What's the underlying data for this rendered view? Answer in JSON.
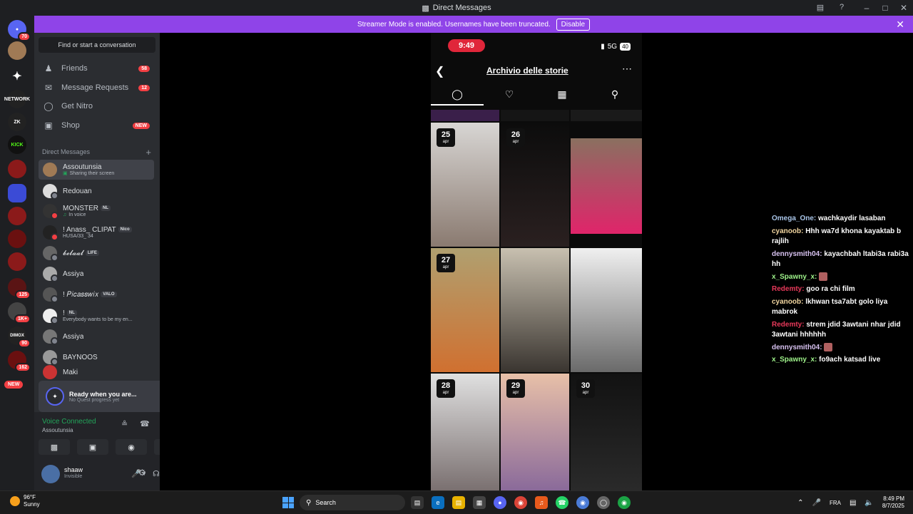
{
  "window": {
    "title": "Direct Messages"
  },
  "banner": {
    "text": "Streamer Mode is enabled. Usernames have been truncated.",
    "disable_label": "Disable"
  },
  "rail": {
    "home_badge": "70",
    "items": [
      {
        "label": "NETWORK"
      },
      {
        "label": "ZK"
      },
      {
        "label": "KICK"
      },
      {
        "badge": "125"
      },
      {
        "badge": "1K+"
      },
      {
        "label": "DIMOX",
        "badge": "90"
      },
      {
        "badge": "162"
      }
    ],
    "new_label": "NEW"
  },
  "sidebar": {
    "search_placeholder": "Find or start a conversation",
    "nav": [
      {
        "label": "Friends",
        "icon": "friends-icon",
        "badge": "58"
      },
      {
        "label": "Message Requests",
        "icon": "mail-icon",
        "badge": "12"
      },
      {
        "label": "Get Nitro",
        "icon": "nitro-icon"
      },
      {
        "label": "Shop",
        "icon": "shop-icon",
        "badge": "NEW"
      }
    ],
    "dm_header": "Direct Messages",
    "dms": [
      {
        "name": "Assoutunsia",
        "sub": "Sharing their screen"
      },
      {
        "name": "Redouan",
        "sub": ""
      },
      {
        "name": "MONSTER",
        "tag": "NL",
        "sub": "In voice"
      },
      {
        "name": "! Anass_ CLIPAT",
        "tag": "Nico",
        "sub": "HUSA/33_ 34"
      },
      {
        "name": "𝓫𝓮𝓵𝓪𝓪𝓵",
        "tag": "LIFE",
        "sub": ""
      },
      {
        "name": "Assiya",
        "sub": ""
      },
      {
        "name": "! 𝑃𝑖𝑐𝑎𝑠𝑠𝑤𝑖𝑥",
        "tag": "VALO",
        "sub": ""
      },
      {
        "name": "!",
        "tag": "NL",
        "sub": "Everybody wants to be my en..."
      },
      {
        "name": "Assiya",
        "sub": ""
      },
      {
        "name": "BAYNOOS",
        "sub": ""
      },
      {
        "name": "Maki",
        "sub": ""
      }
    ],
    "quest": {
      "title": "Ready when you are...",
      "sub": "No Quest progress yet"
    },
    "voice": {
      "status": "Voice Connected",
      "channel": "Assoutunsia"
    },
    "user": {
      "name": "shaaw",
      "status": "Invisible"
    }
  },
  "phone": {
    "time": "9:49",
    "network": "5G",
    "battery": "40",
    "title": "Archivio delle storie",
    "days": [
      {
        "day": "25",
        "month": "apr"
      },
      {
        "day": "26",
        "month": "apr"
      },
      {
        "day": "27",
        "month": "apr"
      },
      {
        "day": "28",
        "month": "apr"
      },
      {
        "day": "29",
        "month": "apr"
      },
      {
        "day": "30",
        "month": "apr"
      }
    ]
  },
  "chat": [
    {
      "user": "Omega_One",
      "color": "#a9c5e8",
      "text": "wachkaydir lasaban"
    },
    {
      "user": "cyanoob",
      "color": "#f2d6a0",
      "text": "Hhh wa7d khona kayaktab b rajlih"
    },
    {
      "user": "dennysmith04",
      "color": "#d9c3f2",
      "text": "kayachbah ltabi3a rabi3a hh"
    },
    {
      "user": "x_Spawny_x",
      "color": "#9ef28a",
      "text": ""
    },
    {
      "user": "Redemty",
      "color": "#e8395a",
      "text": "goo ra chi film"
    },
    {
      "user": "cyanoob",
      "color": "#f2d6a0",
      "text": "lkhwan tsa7abt golo liya mabrok"
    },
    {
      "user": "Redemty",
      "color": "#e8395a",
      "text": "strem jdid 3awtani nhar jdid 3awtani hhhhhh"
    },
    {
      "user": "dennysmith04",
      "color": "#d9c3f2",
      "text": ""
    },
    {
      "user": "x_Spawny_x",
      "color": "#9ef28a",
      "text": "fo9ach katsad live"
    }
  ],
  "taskbar": {
    "temp": "96°F",
    "weather": "Sunny",
    "search": "Search",
    "lang": "FRA",
    "time": "8:49 PM",
    "date": "8/7/2025"
  }
}
